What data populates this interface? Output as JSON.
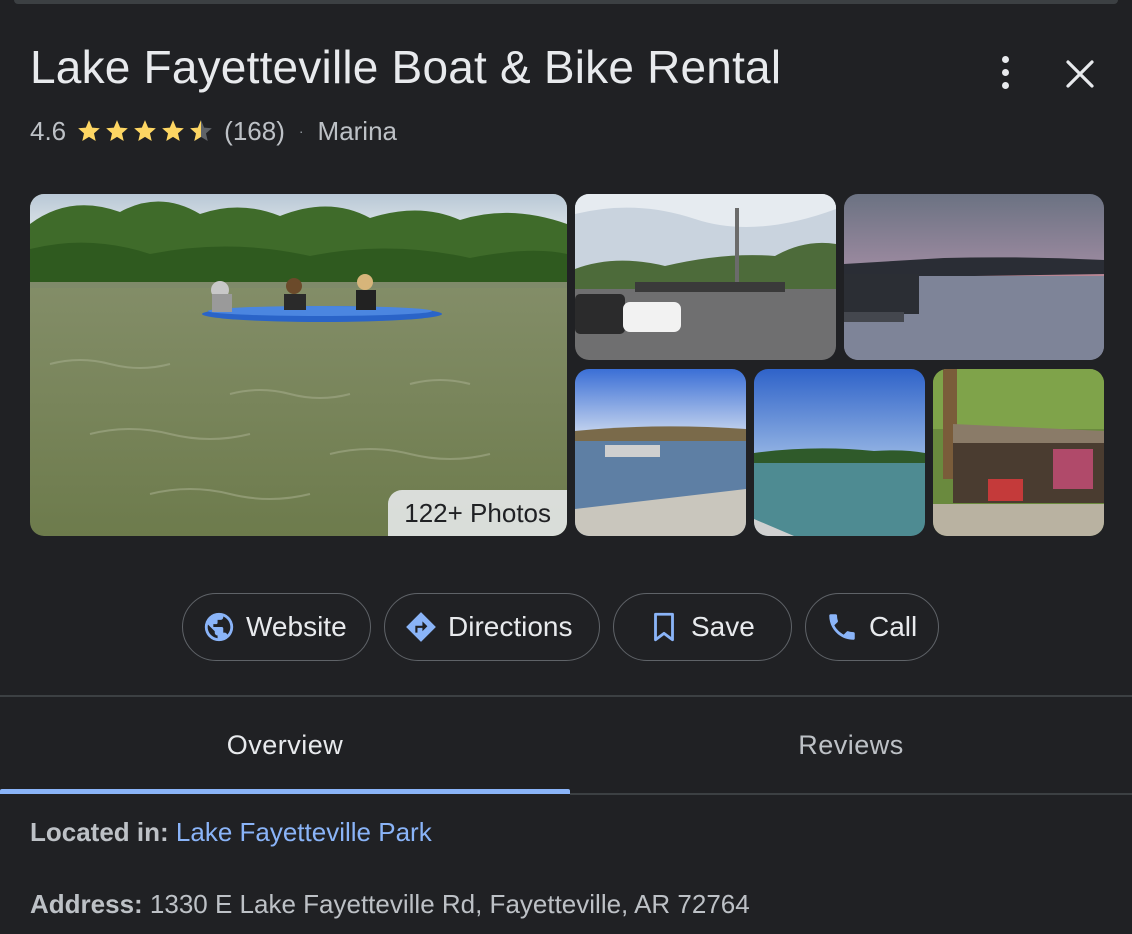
{
  "place": {
    "title": "Lake Fayetteville Boat & Bike Rental",
    "rating": "4.6",
    "rating_value": 4.6,
    "rating_max": 5,
    "review_count": "(168)",
    "separator": "·",
    "category": "Marina"
  },
  "icons": {
    "more": "more-vert-icon",
    "close": "close-icon",
    "star": "star-icon",
    "website": "globe-icon",
    "directions": "directions-icon",
    "save": "bookmark-icon",
    "call": "phone-icon"
  },
  "photos": {
    "count_label": "122+ Photos"
  },
  "actions": {
    "website": "Website",
    "directions": "Directions",
    "save": "Save",
    "call": "Call"
  },
  "tabs": {
    "overview": "Overview",
    "reviews": "Reviews",
    "active": "Overview"
  },
  "info": {
    "located_label": "Located in:",
    "located_value": "Lake Fayetteville Park",
    "address_label": "Address:",
    "address_value": "1330 E Lake Fayetteville Rd, Fayetteville, AR 72764"
  },
  "colors": {
    "background": "#202124",
    "text": "#e8eaed",
    "secondary_text": "#bdc1c6",
    "accent_blue": "#8ab4f8",
    "star_gold": "#fdd663",
    "border": "#5f6368"
  }
}
